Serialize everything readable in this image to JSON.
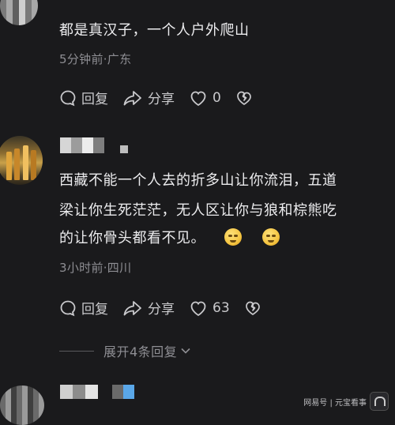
{
  "comment1": {
    "text": "都是真汉子，一个人户外爬山",
    "meta": "5分钟前·广东",
    "reply_label": "回复",
    "share_label": "分享",
    "like_count": "0"
  },
  "comment2": {
    "text_line1": "西藏不能一个人去的折多山让你流泪，五道",
    "text_line2": "梁让你生死茫茫，无人区让你与狼和棕熊吃",
    "text_line3": "的让你骨头都看不见。",
    "meta": "3小时前·四川",
    "reply_label": "回复",
    "share_label": "分享",
    "like_count": "63",
    "expand_label": "展开4条回复"
  },
  "watermark": {
    "text": "网易号 | 元宝看事"
  },
  "icons": {
    "reply": "comment-bubble-icon",
    "share": "share-arrow-icon",
    "like": "heart-outline-icon",
    "dislike": "broken-heart-icon",
    "emoji": "crying-laughing-emoji-icon",
    "expand": "chevron-down-icon"
  }
}
